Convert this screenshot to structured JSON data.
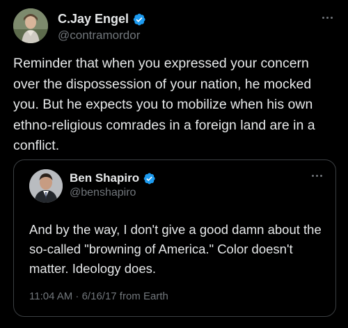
{
  "author": {
    "name": "C.Jay Engel",
    "handle": "@contramordor",
    "verified": true
  },
  "post": {
    "text": "Reminder that when you expressed your concern over the dispossession of your nation, he mocked you. But he expects you to mobilize when his own ethno-religious comrades in a foreign land are in a conflict."
  },
  "quoted": {
    "author": {
      "name": "Ben Shapiro",
      "handle": "@benshapiro",
      "verified": true
    },
    "text": "And by the way, I don't give a good damn about the so-called \"browning of America.\" Color doesn't matter. Ideology does.",
    "timestamp": "11:04 AM · 6/16/17 from Earth"
  },
  "icons": {
    "verified": "verified-badge-icon",
    "more": "more-options-icon"
  },
  "colors": {
    "background": "#000000",
    "text_primary": "#e7e9ea",
    "text_secondary": "#71767b",
    "verified_blue": "#1d9bf0",
    "quote_border": "#3c4043"
  }
}
